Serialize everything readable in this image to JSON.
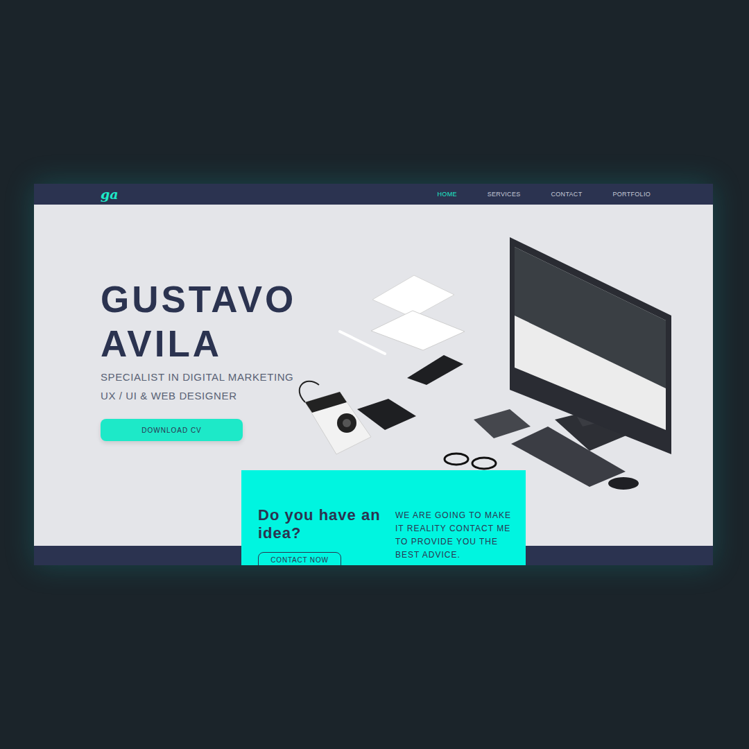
{
  "nav": {
    "logo": "ga",
    "items": [
      {
        "label": "HOME",
        "selected": true
      },
      {
        "label": "SERVICES",
        "selected": false
      },
      {
        "label": "CONTACT",
        "selected": false
      },
      {
        "label": "PORTFOLIO",
        "selected": false
      }
    ]
  },
  "hero": {
    "name_lines": [
      "GUSTAVO",
      "AVILA"
    ],
    "subtitle_lines": [
      "SPECIALIST IN DIGITAL MARKETING",
      "UX / UI & WEB DESIGNER"
    ],
    "button": "DOWNLOAD CV"
  },
  "card": {
    "title": "Do you have an idea?",
    "button": "CONTACT NOW",
    "body": "WE ARE GOING TO MAKE IT REALITY CONTACT ME TO PROVIDE YOU THE BEST ADVICE."
  }
}
